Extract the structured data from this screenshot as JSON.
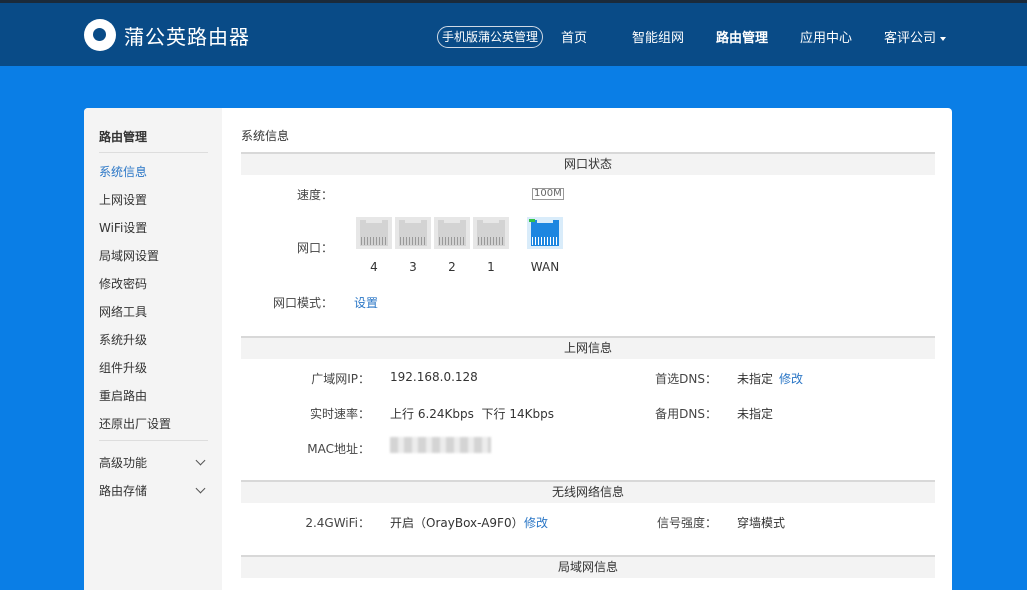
{
  "header": {
    "logo_text": "蒲公英路由器",
    "mobile_link": "手机版蒲公英管理",
    "nav": [
      "首页",
      "智能组网",
      "路由管理",
      "应用中心"
    ],
    "account": "客评公司"
  },
  "sidebar": {
    "title": "路由管理",
    "items": [
      "系统信息",
      "上网设置",
      "WiFi设置",
      "局域网设置",
      "修改密码",
      "网络工具",
      "系统升级",
      "组件升级",
      "重启路由",
      "还原出厂设置"
    ],
    "groups": [
      "高级功能",
      "路由存储"
    ]
  },
  "main": {
    "breadcrumb": "系统信息",
    "port_status": {
      "heading": "网口状态",
      "speed_label": "速度：",
      "speed_value": "100M",
      "ports_label": "网口：",
      "ports": [
        "4",
        "3",
        "2",
        "1",
        "WAN"
      ],
      "mode_label": "网口模式：",
      "mode_link": "设置"
    },
    "internet": {
      "heading": "上网信息",
      "wan_ip_label": "广域网IP：",
      "wan_ip": "192.168.0.128",
      "rate_label": "实时速率：",
      "rate": "上行 6.24Kbps  下行 14Kbps",
      "mac_label": "MAC地址：",
      "dns1_label": "首选DNS：",
      "dns1": "未指定",
      "dns1_edit": "修改",
      "dns2_label": "备用DNS：",
      "dns2": "未指定"
    },
    "wireless": {
      "heading": "无线网络信息",
      "wifi_label": "2.4GWiFi：",
      "wifi_value": "开启（OrayBox-A9F0）",
      "wifi_edit": "修改",
      "signal_label": "信号强度：",
      "signal_value": "穿墙模式"
    },
    "lan": {
      "heading": "局域网信息"
    }
  },
  "colors": {
    "header_bg": "#094b87",
    "page_bg": "#0a7ee6",
    "accent": "#2a76c6",
    "wan_port": "#1c86e0",
    "led": "#33c24a"
  }
}
